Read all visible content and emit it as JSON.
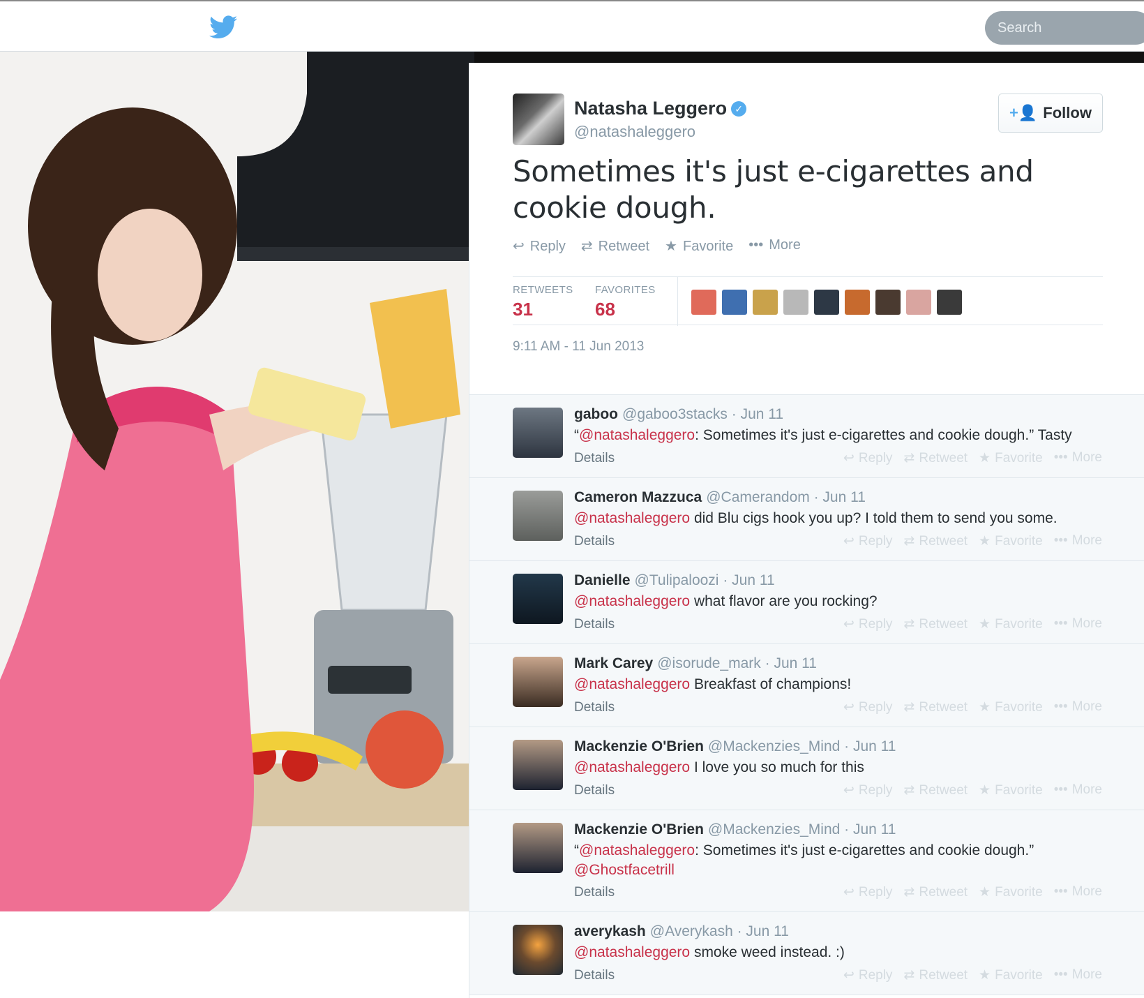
{
  "nav": {
    "search_placeholder": "Search"
  },
  "tweet": {
    "author_name": "Natasha Leggero",
    "author_handle": "@natashaleggero",
    "follow_label": "Follow",
    "text": "Sometimes it's just e-cigarettes and cookie dough.",
    "actions": {
      "reply": "Reply",
      "retweet": "Retweet",
      "favorite": "Favorite",
      "more": "More"
    },
    "stats": {
      "retweets_label": "RETWEETS",
      "retweets": "31",
      "favorites_label": "FAVORITES",
      "favorites": "68"
    },
    "timestamp": "9:11 AM - 11 Jun 2013"
  },
  "reply_actions": {
    "reply": "Reply",
    "retweet": "Retweet",
    "favorite": "Favorite",
    "more": "More",
    "details": "Details"
  },
  "replies": [
    {
      "name": "gaboo",
      "handle": "@gaboo3stacks",
      "date": "· Jun 11",
      "pre": "“",
      "mention": "@natashaleggero",
      "text": ": Sometimes it's just e-cigarettes and cookie dough.” Tasty",
      "extra": ""
    },
    {
      "name": "Cameron Mazzuca",
      "handle": "@Camerandom",
      "date": "· Jun 11",
      "pre": "",
      "mention": "@natashaleggero",
      "text": " did Blu cigs hook you up? I told them to send you some.",
      "extra": ""
    },
    {
      "name": "Danielle",
      "handle": "@Tulipaloozi",
      "date": "· Jun 11",
      "pre": "",
      "mention": "@natashaleggero",
      "text": " what flavor are you rocking?",
      "extra": ""
    },
    {
      "name": "Mark Carey",
      "handle": "@isorude_mark",
      "date": "· Jun 11",
      "pre": "",
      "mention": "@natashaleggero",
      "text": " Breakfast of champions!",
      "extra": ""
    },
    {
      "name": "Mackenzie O'Brien",
      "handle": "@Mackenzies_Mind",
      "date": "· Jun 11",
      "pre": "",
      "mention": "@natashaleggero",
      "text": " I love you so much for this",
      "extra": ""
    },
    {
      "name": "Mackenzie O'Brien",
      "handle": "@Mackenzies_Mind",
      "date": "· Jun 11",
      "pre": "“",
      "mention": "@natashaleggero",
      "text": ": Sometimes it's just e-cigarettes and cookie dough.”",
      "extra": "@Ghostfacetrill"
    },
    {
      "name": "averykash",
      "handle": "@Averykash",
      "date": "· Jun 11",
      "pre": "",
      "mention": "@natashaleggero",
      "text": " smoke weed instead. :)",
      "extra": ""
    }
  ],
  "colors": {
    "accent": "#55acee",
    "mention": "#c8324a",
    "muted": "#8899a6"
  }
}
